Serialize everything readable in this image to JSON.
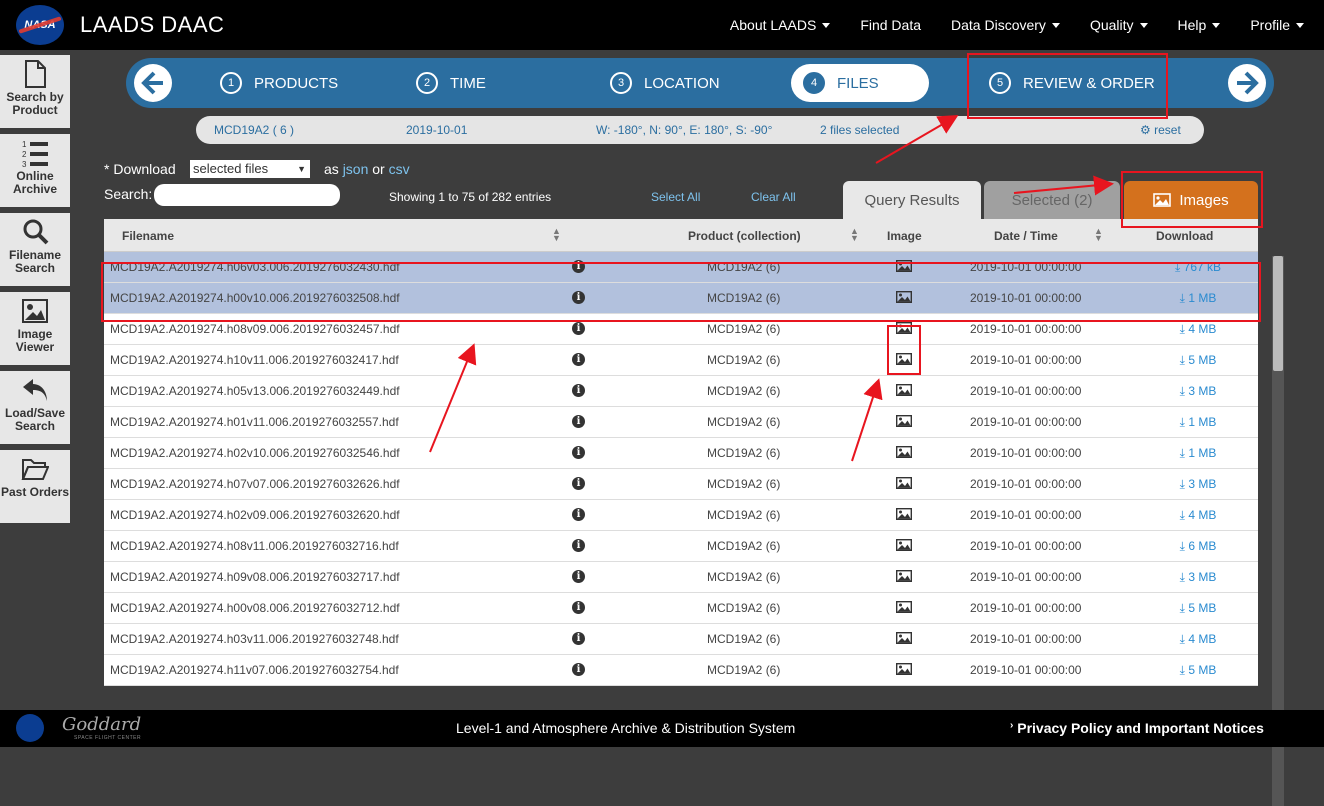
{
  "header": {
    "logo_text": "NASA",
    "title": "LAADS DAAC",
    "nav": [
      "About LAADS",
      "Find Data",
      "Data Discovery",
      "Quality",
      "Help",
      "Profile"
    ]
  },
  "sidebar": {
    "items": [
      {
        "label": "Search by Product",
        "icon": "document-icon"
      },
      {
        "label": "Online Archive",
        "icon": "numbered-list-icon"
      },
      {
        "label": "Filename Search",
        "icon": "magnifier-icon"
      },
      {
        "label": "Image Viewer",
        "icon": "image-icon"
      },
      {
        "label": "Load/Save Search",
        "icon": "undo-arrow-icon"
      },
      {
        "label": "Past Orders",
        "icon": "folder-open-icon"
      }
    ]
  },
  "steps": [
    {
      "num": "1",
      "label": "PRODUCTS"
    },
    {
      "num": "2",
      "label": "TIME"
    },
    {
      "num": "3",
      "label": "LOCATION"
    },
    {
      "num": "4",
      "label": "FILES"
    },
    {
      "num": "5",
      "label": "REVIEW & ORDER"
    }
  ],
  "summary": {
    "product": "MCD19A2 ( 6 )",
    "date": "2019-10-01",
    "location": "W: -180°, N: 90°, E: 180°, S: -90°",
    "selected": "2 files selected",
    "reset": "reset"
  },
  "controls": {
    "download_label": "* Download",
    "download_select": "selected files",
    "as_text": "as",
    "json_link": "json",
    "or_text": "or",
    "csv_link": "csv",
    "search_label": "Search:",
    "showing": "Showing 1 to 75 of 282 entries",
    "select_all": "Select All",
    "clear_all": "Clear All"
  },
  "tabs": {
    "query": "Query Results",
    "selected": "Selected (2)",
    "images": "Images"
  },
  "table": {
    "headers": {
      "filename": "Filename",
      "product": "Product (collection)",
      "image": "Image",
      "datetime": "Date / Time",
      "download": "Download"
    },
    "rows": [
      {
        "filename": "MCD19A2.A2019274.h06v03.006.2019276032430.hdf",
        "product": "MCD19A2 (6)",
        "datetime": "2019-10-01 00:00:00",
        "size": "767 kB",
        "selected": true
      },
      {
        "filename": "MCD19A2.A2019274.h00v10.006.2019276032508.hdf",
        "product": "MCD19A2 (6)",
        "datetime": "2019-10-01 00:00:00",
        "size": "1 MB",
        "selected": true
      },
      {
        "filename": "MCD19A2.A2019274.h08v09.006.2019276032457.hdf",
        "product": "MCD19A2 (6)",
        "datetime": "2019-10-01 00:00:00",
        "size": "4 MB",
        "selected": false
      },
      {
        "filename": "MCD19A2.A2019274.h10v11.006.2019276032417.hdf",
        "product": "MCD19A2 (6)",
        "datetime": "2019-10-01 00:00:00",
        "size": "5 MB",
        "selected": false
      },
      {
        "filename": "MCD19A2.A2019274.h05v13.006.2019276032449.hdf",
        "product": "MCD19A2 (6)",
        "datetime": "2019-10-01 00:00:00",
        "size": "3 MB",
        "selected": false
      },
      {
        "filename": "MCD19A2.A2019274.h01v11.006.2019276032557.hdf",
        "product": "MCD19A2 (6)",
        "datetime": "2019-10-01 00:00:00",
        "size": "1 MB",
        "selected": false
      },
      {
        "filename": "MCD19A2.A2019274.h02v10.006.2019276032546.hdf",
        "product": "MCD19A2 (6)",
        "datetime": "2019-10-01 00:00:00",
        "size": "1 MB",
        "selected": false
      },
      {
        "filename": "MCD19A2.A2019274.h07v07.006.2019276032626.hdf",
        "product": "MCD19A2 (6)",
        "datetime": "2019-10-01 00:00:00",
        "size": "3 MB",
        "selected": false
      },
      {
        "filename": "MCD19A2.A2019274.h02v09.006.2019276032620.hdf",
        "product": "MCD19A2 (6)",
        "datetime": "2019-10-01 00:00:00",
        "size": "4 MB",
        "selected": false
      },
      {
        "filename": "MCD19A2.A2019274.h08v11.006.2019276032716.hdf",
        "product": "MCD19A2 (6)",
        "datetime": "2019-10-01 00:00:00",
        "size": "6 MB",
        "selected": false
      },
      {
        "filename": "MCD19A2.A2019274.h09v08.006.2019276032717.hdf",
        "product": "MCD19A2 (6)",
        "datetime": "2019-10-01 00:00:00",
        "size": "3 MB",
        "selected": false
      },
      {
        "filename": "MCD19A2.A2019274.h00v08.006.2019276032712.hdf",
        "product": "MCD19A2 (6)",
        "datetime": "2019-10-01 00:00:00",
        "size": "5 MB",
        "selected": false
      },
      {
        "filename": "MCD19A2.A2019274.h03v11.006.2019276032748.hdf",
        "product": "MCD19A2 (6)",
        "datetime": "2019-10-01 00:00:00",
        "size": "4 MB",
        "selected": false
      },
      {
        "filename": "MCD19A2.A2019274.h11v07.006.2019276032754.hdf",
        "product": "MCD19A2 (6)",
        "datetime": "2019-10-01 00:00:00",
        "size": "5 MB",
        "selected": false
      }
    ]
  },
  "footer": {
    "org": "Goddard",
    "org_sub": "SPACE FLIGHT CENTER",
    "center": "Level-1 and Atmosphere Archive & Distribution System",
    "right": "Privacy Policy and Important Notices"
  },
  "colors": {
    "header_bg": "#000000",
    "step_bar": "#2b6ea0",
    "images_tab": "#d4711d",
    "selected_row": "#b2c1dd",
    "annotation": "#e8151f"
  }
}
